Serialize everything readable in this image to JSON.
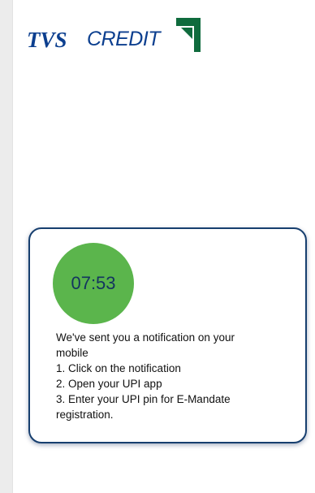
{
  "logo": {
    "part1": "TVS",
    "part2": "CREDIT",
    "colors": {
      "text": "#0c3f8f",
      "mark": "#0f6b3d"
    }
  },
  "card": {
    "timer": "07:53",
    "timer_color": "#5bb54c",
    "border_color": "#173f6f",
    "lines": [
      "We've sent you a notification on your",
      "mobile",
      "1. Click on the notification",
      "2. Open your UPI app",
      "3. Enter your UPI pin for E-Mandate",
      "registration."
    ]
  }
}
